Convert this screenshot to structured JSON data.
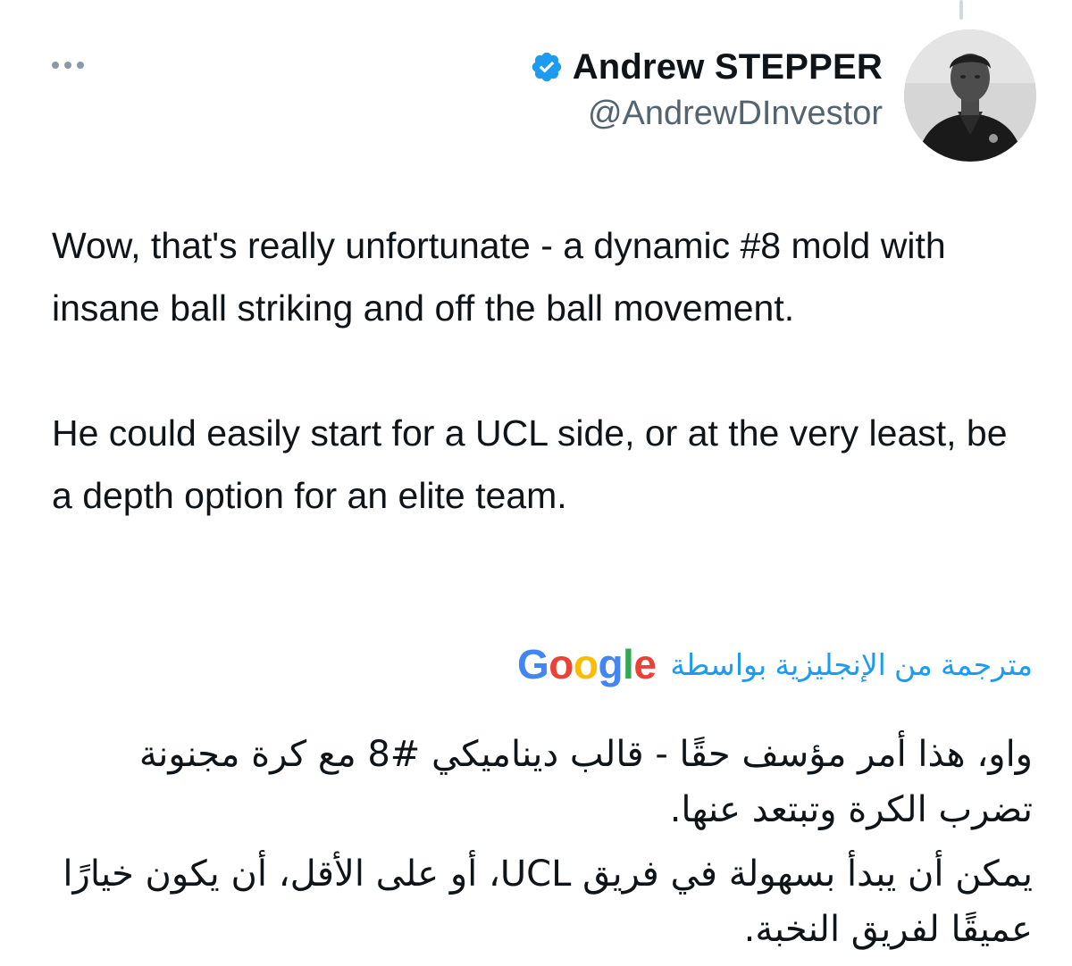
{
  "author": {
    "display_name": "Andrew STEPPER",
    "handle": "@AndrewDInvestor",
    "verified": true,
    "avatar_icon": "profile-photo"
  },
  "tweet": {
    "paragraphs": [
      "Wow, that's really unfortunate - a dynamic #8 mold with insane ball striking and off the ball movement.",
      "He could easily start for a UCL side, or at the very least, be a depth option for an elite team."
    ]
  },
  "translation": {
    "label": "مترجمة من الإنجليزية بواسطة",
    "provider": "Google",
    "paragraphs": [
      "واو، هذا أمر مؤسف حقًا - قالب ديناميكي #8 مع كرة مجنونة تضرب الكرة وتبتعد عنها.",
      "يمكن أن يبدأ بسهولة في فريق UCL، أو على الأقل، أن يكون خيارًا عميقًا لفريق النخبة."
    ]
  },
  "colors": {
    "text": "#0f1419",
    "secondary": "#536471",
    "accent": "#1d9bf0",
    "verified": "#1d9bf0",
    "google_blue": "#4285F4",
    "google_red": "#EA4335",
    "google_yellow": "#FBBC05",
    "google_green": "#34A853"
  },
  "icons": {
    "more": "more-horizontal-icon",
    "verified": "verified-badge-icon"
  }
}
